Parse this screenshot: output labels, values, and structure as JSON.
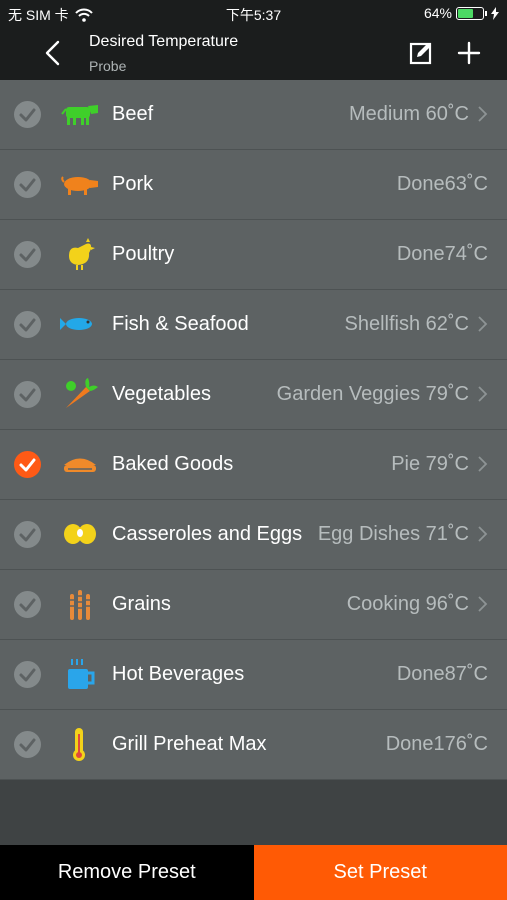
{
  "status_bar": {
    "carrier": "无 SIM 卡",
    "time": "下午5:37",
    "battery": "64%",
    "battery_level": 0.64
  },
  "header": {
    "title": "Desired Temperature",
    "subtitle": "Probe"
  },
  "presets": [
    {
      "name": "Beef",
      "value": "Medium 60˚C",
      "selected": false,
      "icon": "cow-icon",
      "color": "#3fcf2a",
      "chevron": true
    },
    {
      "name": "Pork",
      "value": "Done63˚C",
      "selected": false,
      "icon": "pig-icon",
      "color": "#f0821c",
      "chevron": false
    },
    {
      "name": "Poultry",
      "value": "Done74˚C",
      "selected": false,
      "icon": "chicken-icon",
      "color": "#f3d21a",
      "chevron": false
    },
    {
      "name": "Fish & Seafood",
      "value": "Shellfish 62˚C",
      "selected": false,
      "icon": "fish-icon",
      "color": "#23a8e8",
      "chevron": true
    },
    {
      "name": "Vegetables",
      "value": "Garden Veggies 79˚C",
      "selected": false,
      "icon": "carrot-icon",
      "color": "#f07a1e",
      "chevron": true
    },
    {
      "name": "Baked Goods",
      "value": "Pie 79˚C",
      "selected": true,
      "icon": "pie-icon",
      "color": "#f08a2a",
      "chevron": true
    },
    {
      "name": "Casseroles and Eggs",
      "value": "Egg Dishes 71˚C",
      "selected": false,
      "icon": "eggs-icon",
      "color": "#f3d21a",
      "chevron": true
    },
    {
      "name": "Grains",
      "value": "Cooking 96˚C",
      "selected": false,
      "icon": "wheat-icon",
      "color": "#e88a3a",
      "chevron": true
    },
    {
      "name": "Hot Beverages",
      "value": "Done87˚C",
      "selected": false,
      "icon": "cup-icon",
      "color": "#2aa5ea",
      "chevron": false
    },
    {
      "name": "Grill Preheat Max",
      "value": "Done176˚C",
      "selected": false,
      "icon": "thermometer-icon",
      "color": "#f3d21a",
      "chevron": false
    }
  ],
  "footer": {
    "remove_label": "Remove Preset",
    "set_label": "Set Preset"
  },
  "colors": {
    "accent": "#ff5a05",
    "row_bg": "#5d6263"
  }
}
